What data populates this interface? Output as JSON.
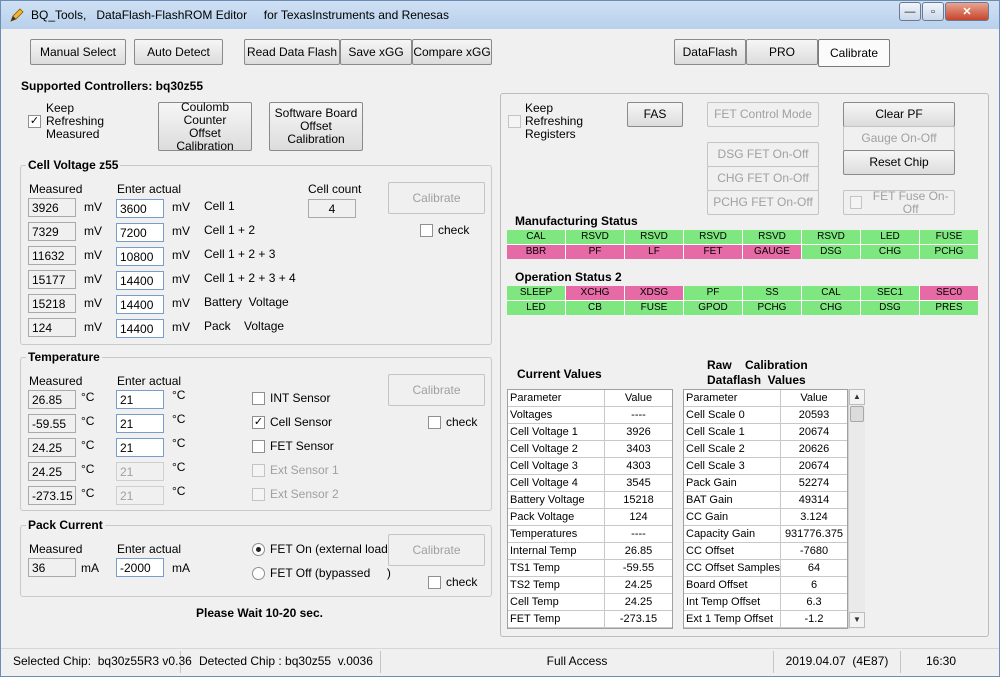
{
  "window": {
    "title": "BQ_Tools,   DataFlash-FlashROM Editor     for TexasInstruments and Renesas",
    "icons": {
      "app": "pencil-icon",
      "minimize": "minimize-icon",
      "maximize": "maximize-icon",
      "close": "close-icon"
    },
    "buttons": {
      "minimize": "—",
      "maximize": "▫",
      "close": "✕"
    }
  },
  "toolbar": {
    "manual_select": "Manual Select",
    "auto_detect": "Auto Detect",
    "read_data_flash": "Read Data Flash",
    "save_xgg": "Save xGG",
    "compare_xgg": "Compare xGG",
    "tab_dataflash": "DataFlash",
    "tab_pro": "PRO",
    "tab_calibrate": "Calibrate"
  },
  "supported_controllers": "Supported Controllers: bq30z55",
  "left": {
    "keep_refreshing": {
      "line1": "Keep",
      "line2": "Refreshing",
      "line3": "Measured",
      "checked_mark": "✓"
    },
    "coulomb_btn": {
      "line1": "Coulomb Counter",
      "line2": "Offset Calibration"
    },
    "software_btn": {
      "line1": "Software Board",
      "line2": "Offset Calibration"
    },
    "cell_voltage": {
      "title": "Cell Voltage z55",
      "measured_header": "Measured",
      "enter_header": "Enter actual",
      "cell_count_label": "Cell count",
      "cell_count": "4",
      "calibrate": "Calibrate",
      "check": "check",
      "rows": [
        {
          "measured": "3926",
          "unit1": "mV",
          "actual": "3600",
          "unit2": "mV",
          "label": "Cell 1"
        },
        {
          "measured": "7329",
          "unit1": "mV",
          "actual": "7200",
          "unit2": "mV",
          "label": "Cell 1 + 2"
        },
        {
          "measured": "11632",
          "unit1": "mV",
          "actual": "10800",
          "unit2": "mV",
          "label": "Cell 1 + 2 + 3"
        },
        {
          "measured": "15177",
          "unit1": "mV",
          "actual": "14400",
          "unit2": "mV",
          "label": "Cell 1 + 2 + 3 + 4"
        },
        {
          "measured": "15218",
          "unit1": "mV",
          "actual": "14400",
          "unit2": "mV",
          "label": "Battery  Voltage"
        },
        {
          "measured": "124",
          "unit1": "mV",
          "actual": "14400",
          "unit2": "mV",
          "label": "Pack    Voltage"
        }
      ]
    },
    "temperature": {
      "title": "Temperature",
      "measured_header": "Measured",
      "enter_header": "Enter actual",
      "calibrate": "Calibrate",
      "check": "check",
      "rows": [
        {
          "measured": "26.85",
          "unit1": "°C",
          "actual": "21",
          "unit2": "°C",
          "sensor": "INT Sensor",
          "checked": "",
          "enabled": true
        },
        {
          "measured": "-59.55",
          "unit1": "°C",
          "actual": "21",
          "unit2": "°C",
          "sensor": "Cell Sensor",
          "checked": "✓",
          "enabled": true
        },
        {
          "measured": "24.25",
          "unit1": "°C",
          "actual": "21",
          "unit2": "°C",
          "sensor": "FET Sensor",
          "checked": "",
          "enabled": true
        },
        {
          "measured": "24.25",
          "unit1": "°C",
          "actual": "21",
          "unit2": "°C",
          "sensor": "Ext Sensor 1",
          "checked": "",
          "enabled": false
        },
        {
          "measured": "-273.15",
          "unit1": "°C",
          "actual": "21",
          "unit2": "°C",
          "sensor": "Ext Sensor 2",
          "checked": "",
          "enabled": false
        }
      ]
    },
    "pack_current": {
      "title": "Pack Current",
      "measured_header": "Measured",
      "enter_header": "Enter actual",
      "measured": "36",
      "unit1": "mA",
      "actual": "-2000",
      "unit2": "mA",
      "fet_on": "FET On (external load)",
      "fet_off": "FET Off (bypassed     )",
      "calibrate": "Calibrate",
      "check": "check"
    },
    "please_wait": "Please Wait 10-20 sec."
  },
  "right": {
    "keep_refreshing": {
      "line1": "Keep",
      "line2": "Refreshing",
      "line3": "Registers"
    },
    "fas": "FAS",
    "fet_control_mode": "FET Control Mode",
    "dsg_fet": "DSG   FET   On-Off",
    "chg_fet": "CHG   FET   On-Off",
    "pchg_fet": "PCHG  FET   On-Off",
    "clear_pf": "Clear PF",
    "gauge_on_off": "Gauge On-Off",
    "reset_chip": "Reset Chip",
    "fet_fuse": "FET Fuse On-Off",
    "colors": {
      "green": "#7fe77f",
      "pink": "#e66aa5"
    },
    "manufacturing_status": {
      "title": "Manufacturing Status",
      "cells": [
        {
          "label": "CAL",
          "color": "green"
        },
        {
          "label": "RSVD",
          "color": "green"
        },
        {
          "label": "RSVD",
          "color": "green"
        },
        {
          "label": "RSVD",
          "color": "green"
        },
        {
          "label": "RSVD",
          "color": "green"
        },
        {
          "label": "RSVD",
          "color": "green"
        },
        {
          "label": "LED",
          "color": "green"
        },
        {
          "label": "FUSE",
          "color": "green"
        },
        {
          "label": "BBR",
          "color": "pink"
        },
        {
          "label": "PF",
          "color": "pink"
        },
        {
          "label": "LF",
          "color": "pink"
        },
        {
          "label": "FET",
          "color": "pink"
        },
        {
          "label": "GAUGE",
          "color": "pink"
        },
        {
          "label": "DSG",
          "color": "green"
        },
        {
          "label": "CHG",
          "color": "green"
        },
        {
          "label": "PCHG",
          "color": "green"
        }
      ]
    },
    "operation_status": {
      "title": "Operation Status 2",
      "cells": [
        {
          "label": "SLEEP",
          "color": "green"
        },
        {
          "label": "XCHG",
          "color": "pink"
        },
        {
          "label": "XDSG",
          "color": "pink"
        },
        {
          "label": "PF",
          "color": "green"
        },
        {
          "label": "SS",
          "color": "green"
        },
        {
          "label": "CAL",
          "color": "green"
        },
        {
          "label": "SEC1",
          "color": "green"
        },
        {
          "label": "SEC0",
          "color": "pink"
        },
        {
          "label": "LED",
          "color": "green"
        },
        {
          "label": "CB",
          "color": "green"
        },
        {
          "label": "FUSE",
          "color": "green"
        },
        {
          "label": "GPOD",
          "color": "green"
        },
        {
          "label": "PCHG",
          "color": "green"
        },
        {
          "label": "CHG",
          "color": "green"
        },
        {
          "label": "DSG",
          "color": "green"
        },
        {
          "label": "PRES",
          "color": "green"
        }
      ]
    },
    "current_values": {
      "title": "Current Values",
      "headers": [
        "Parameter",
        "Value"
      ],
      "rows": [
        [
          "Voltages",
          "----"
        ],
        [
          "Cell Voltage 1",
          "3926"
        ],
        [
          "Cell Voltage 2",
          "3403"
        ],
        [
          "Cell Voltage 3",
          "4303"
        ],
        [
          "Cell Voltage 4",
          "3545"
        ],
        [
          "Battery Voltage",
          "15218"
        ],
        [
          "Pack Voltage",
          "124"
        ],
        [
          "Temperatures",
          "----"
        ],
        [
          "Internal Temp",
          "26.85"
        ],
        [
          "TS1 Temp",
          "-59.55"
        ],
        [
          "TS2 Temp",
          "24.25"
        ],
        [
          "Cell Temp",
          "24.25"
        ],
        [
          "FET Temp",
          "-273.15"
        ]
      ]
    },
    "raw_calibration": {
      "title_line1": "Raw    Calibration",
      "title_line2": "Dataflash  Values",
      "headers": [
        "Parameter",
        "Value"
      ],
      "rows": [
        [
          "Cell Scale 0",
          "20593"
        ],
        [
          "Cell Scale 1",
          "20674"
        ],
        [
          "Cell Scale 2",
          "20626"
        ],
        [
          "Cell Scale 3",
          "20674"
        ],
        [
          "Pack Gain",
          "52274"
        ],
        [
          "BAT Gain",
          "49314"
        ],
        [
          "CC Gain",
          "3.124"
        ],
        [
          "Capacity Gain",
          "931776.375"
        ],
        [
          "CC Offset",
          "-7680"
        ],
        [
          "CC Offset Samples",
          "64"
        ],
        [
          "Board Offset",
          "6"
        ],
        [
          "Int Temp Offset",
          "6.3"
        ],
        [
          "Ext 1 Temp Offset",
          "-1.2"
        ]
      ],
      "scroll_up": "▲",
      "scroll_down": "▼"
    }
  },
  "statusbar": {
    "selected_chip": "Selected Chip:  bq30z55R3 v0.36",
    "detected_chip": "Detected Chip : bq30z55  v.0036",
    "access": "Full Access",
    "date": "2019.04.07  (4E87)",
    "time": "16:30"
  }
}
